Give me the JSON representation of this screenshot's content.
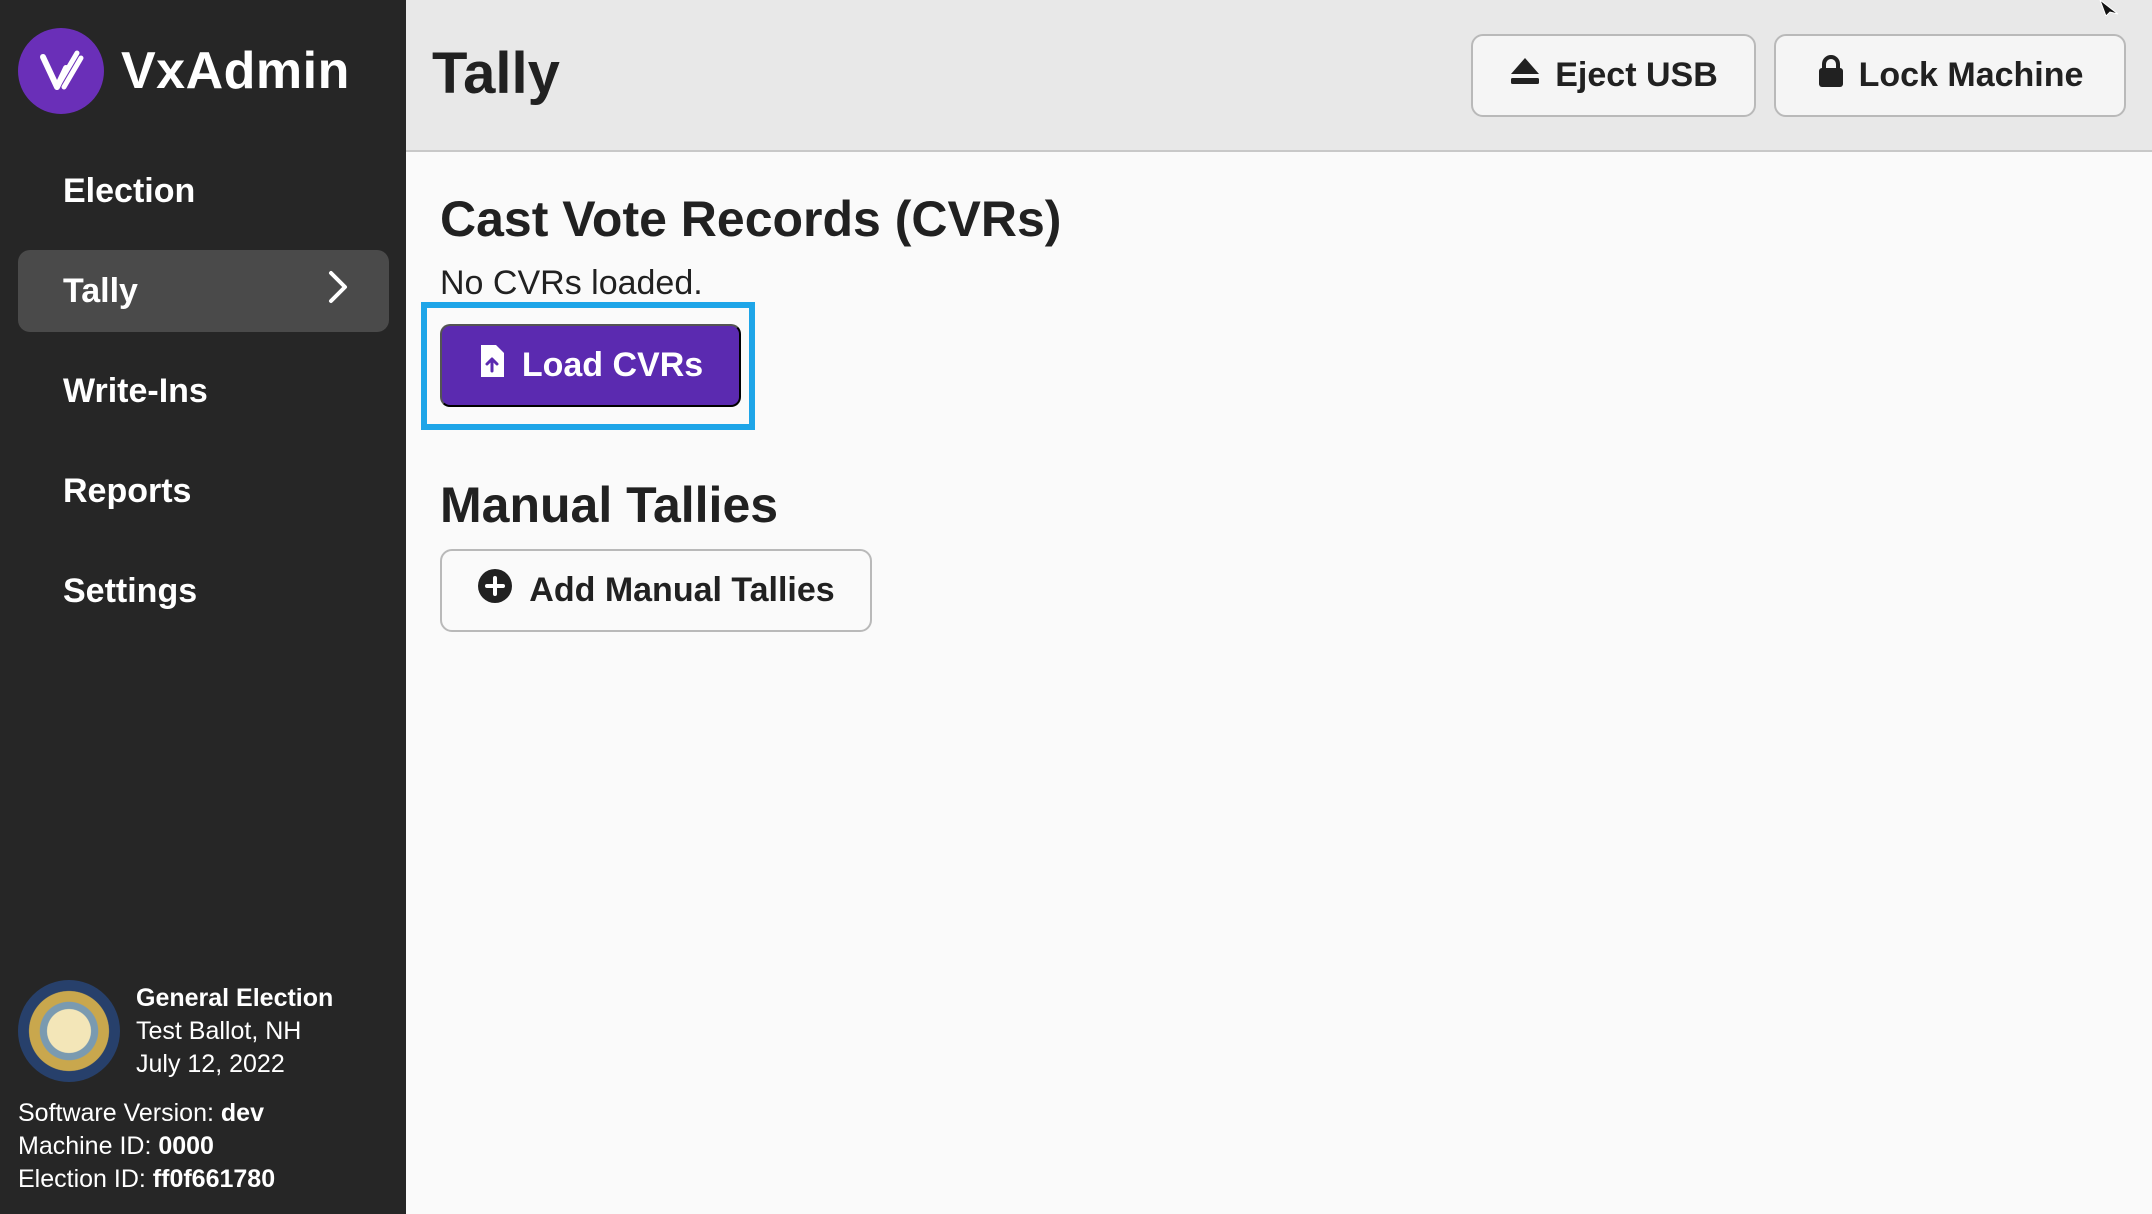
{
  "app": {
    "name": "VxAdmin"
  },
  "colors": {
    "accent": "#5b2ab0",
    "focus": "#1ea5e8",
    "sidebar": "#262626"
  },
  "sidebar": {
    "items": [
      {
        "label": "Election",
        "active": false
      },
      {
        "label": "Tally",
        "active": true
      },
      {
        "label": "Write-Ins",
        "active": false
      },
      {
        "label": "Reports",
        "active": false
      },
      {
        "label": "Settings",
        "active": false
      }
    ],
    "election": {
      "name": "General Election",
      "ballot": "Test Ballot, NH",
      "date": "July 12, 2022"
    },
    "software_version_label": "Software Version:",
    "software_version": "dev",
    "machine_id_label": "Machine ID:",
    "machine_id": "0000",
    "election_id_label": "Election ID:",
    "election_id": "ff0f661780"
  },
  "header": {
    "title": "Tally",
    "eject_label": "Eject USB",
    "lock_label": "Lock Machine"
  },
  "main": {
    "cvr_title": "Cast Vote Records (CVRs)",
    "cvr_status": "No CVRs loaded.",
    "load_cvrs_label": "Load CVRs",
    "manual_title": "Manual Tallies",
    "add_manual_label": "Add Manual Tallies"
  },
  "icons": {
    "brand": "vx-logo-icon",
    "chevron": "chevron-right-icon",
    "eject": "eject-icon",
    "lock": "lock-icon",
    "file_upload": "file-upload-icon",
    "add": "plus-circle-icon",
    "seal": "state-seal",
    "cursor": "cursor-icon"
  }
}
